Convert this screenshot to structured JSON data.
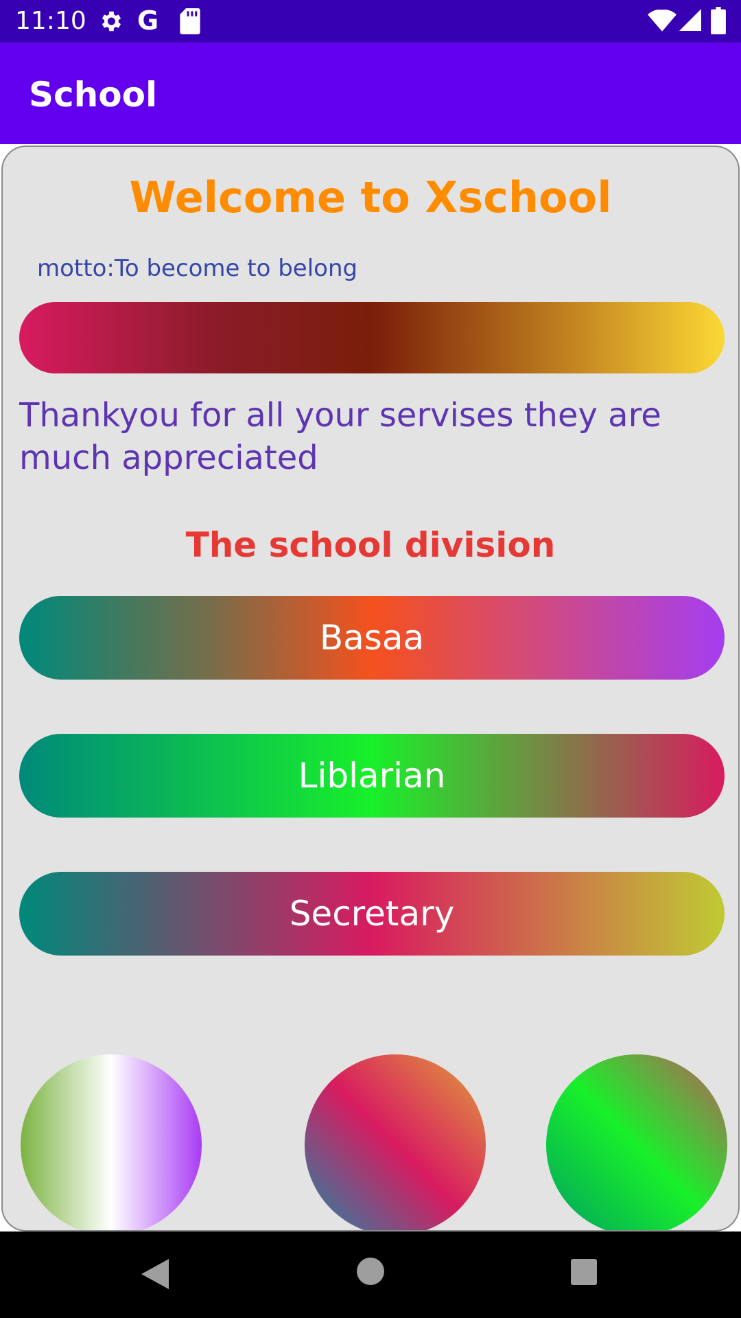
{
  "status_bar": {
    "time": "11:10",
    "icons": [
      "gear-icon",
      "google-icon",
      "sd-card-icon",
      "wifi-icon",
      "signal-icon",
      "battery-icon"
    ]
  },
  "app_bar": {
    "title": "School"
  },
  "card": {
    "welcome": "Welcome to Xschool",
    "motto": "motto:To become to belong",
    "thanks": "Thankyou for all your servises they are much appreciated",
    "division_title": "The school division",
    "buttons": [
      "Basaa",
      "Liblarian",
      "Secretary"
    ]
  },
  "colors": {
    "status_bar": "#3700B3",
    "app_bar": "#6200EE",
    "card_bg": "#E3E3E3",
    "welcome": "#FF8C00",
    "motto": "#3646A8",
    "thanks": "#5E35B1",
    "division": "#E53935"
  },
  "nav_bar": {
    "icons": [
      "back-icon",
      "home-icon",
      "recents-icon"
    ]
  }
}
